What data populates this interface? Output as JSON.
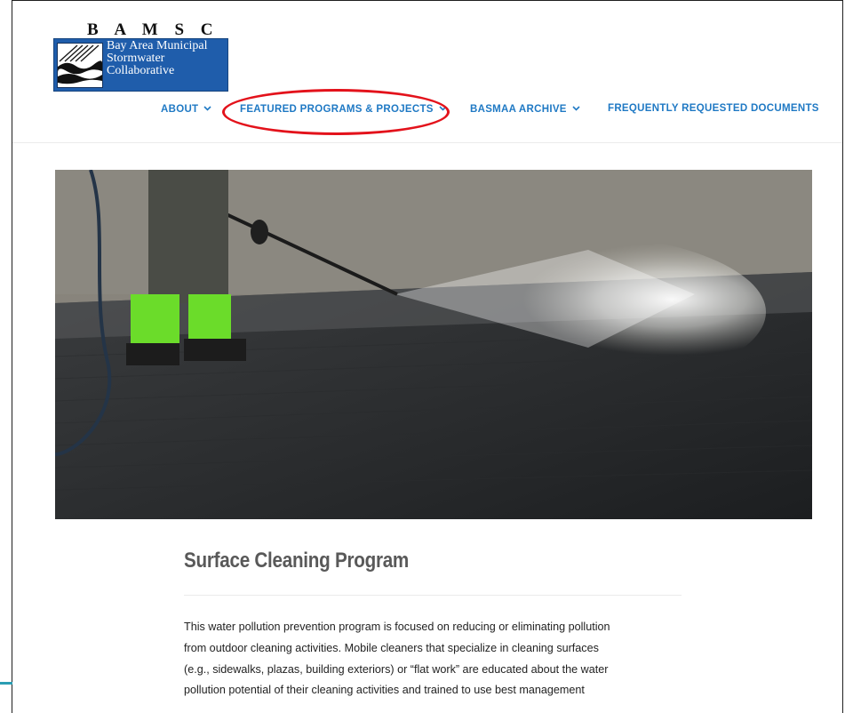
{
  "logo": {
    "letters": "B A M S C",
    "lines": [
      "Bay Area Municipal",
      "Stormwater",
      "Collaborative"
    ]
  },
  "nav": {
    "items": [
      {
        "label": "ABOUT",
        "chevron": "⌄"
      },
      {
        "label": "FEATURED PROGRAMS & PROJECTS",
        "chevron": "⌄"
      },
      {
        "label": "BASMAA ARCHIVE",
        "chevron": "⌄"
      },
      {
        "label": "FREQUENTLY REQUESTED DOCUMENTS"
      }
    ]
  },
  "colors": {
    "nav_link": "#1f79c4",
    "annotation": "#e3121b",
    "logo_bg": "#1f5dab"
  },
  "hero": {
    "icon": "pressure-washing-photo"
  },
  "content": {
    "title": "Surface Cleaning Program",
    "body_lines": [
      "This water pollution prevention program is focused on reducing or eliminating pollution",
      "from outdoor cleaning activities. Mobile cleaners that specialize in cleaning surfaces",
      "(e.g., sidewalks, plazas, building exteriors) or “flat work” are educated about the water",
      "pollution potential of their cleaning activities and trained to use best management"
    ]
  }
}
